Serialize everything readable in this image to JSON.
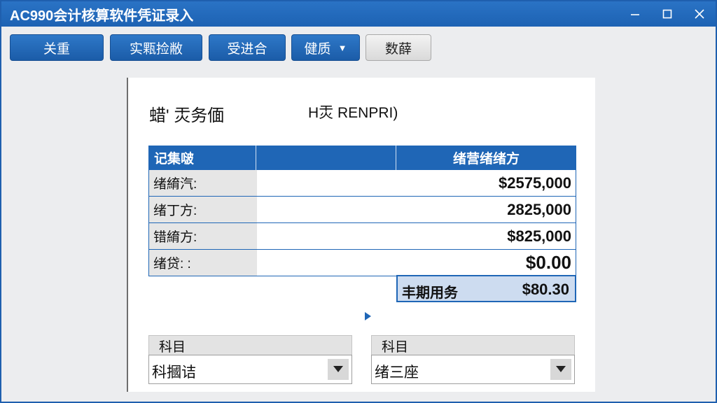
{
  "window": {
    "title": "AC990会计核算软件凭证录入",
    "controls": {
      "minimize": "minimize-icon",
      "maximize": "maximize-icon",
      "close": "close-icon"
    }
  },
  "toolbar": {
    "buttons": [
      {
        "label": "关重"
      },
      {
        "label": "实㼫捡敝"
      },
      {
        "label": "受进合"
      },
      {
        "label": "健质",
        "has_dropdown": true
      },
      {
        "label": "数薛"
      }
    ]
  },
  "voucher": {
    "header_left": "蜡' 㶣务偭",
    "header_right": "H㶣 RENPRI)"
  },
  "grid": {
    "columns": [
      "记集啵",
      "",
      "绪营绪绪方"
    ],
    "rows": [
      {
        "label": "绪䋭汽:",
        "value": "$2575,000"
      },
      {
        "label": "绪丁方:",
        "value": "2825,000"
      },
      {
        "label": "错䋭方:",
        "value": "$825,000"
      },
      {
        "label": "绪贷:  :",
        "value": "$0.00"
      }
    ],
    "summary": {
      "label": "丰期用务",
      "value": "$80.30"
    }
  },
  "combos": [
    {
      "tab": "科目",
      "value": "科摑诘"
    },
    {
      "tab": "科目",
      "value": "绪三座"
    }
  ],
  "colors": {
    "accent": "#1f66b6",
    "titlebar": "#1d62b3",
    "summary_bg": "#cddcf0"
  }
}
